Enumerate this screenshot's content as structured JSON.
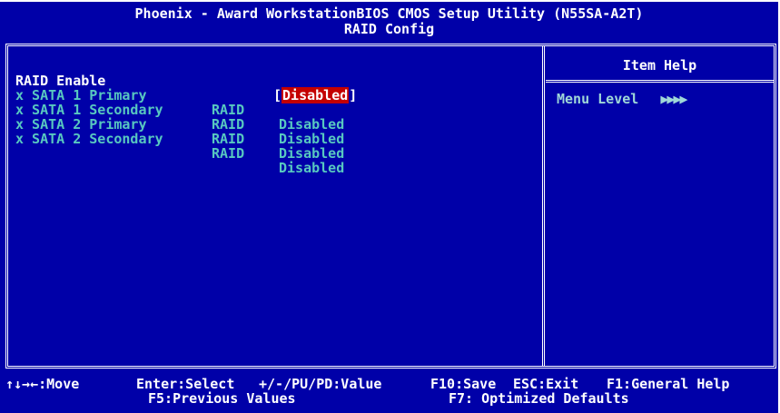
{
  "title": {
    "line1": "Phoenix - Award WorkstationBIOS CMOS Setup Utility (N55SA-A2T)",
    "line2": "RAID Config"
  },
  "settings": {
    "raid_enable": {
      "label": "RAID Enable",
      "value": "Disabled"
    },
    "items": [
      {
        "label": "x SATA 1 Primary",
        "mid": "RAID",
        "value": "Disabled"
      },
      {
        "label": "x SATA 1 Secondary",
        "mid": "RAID",
        "value": "Disabled"
      },
      {
        "label": "x SATA 2 Primary",
        "mid": "RAID",
        "value": "Disabled"
      },
      {
        "label": "x SATA 2 Secondary",
        "mid": "RAID",
        "value": "Disabled"
      }
    ]
  },
  "help": {
    "title": "Item Help",
    "menu_level_label": "Menu Level",
    "menu_level_arrows": "▶▶▶▶"
  },
  "footer": {
    "move": "↑↓→←:Move",
    "enter": "Enter:Select",
    "value": "+/-/PU/PD:Value",
    "save": "F10:Save",
    "exit": "ESC:Exit",
    "help": "F1:General Help",
    "prev": "F5:Previous Values",
    "optimized": "F7: Optimized Defaults"
  },
  "colors": {
    "background": "#0000a8",
    "selection": "#c40000",
    "disabled_text": "#58c8c0"
  }
}
